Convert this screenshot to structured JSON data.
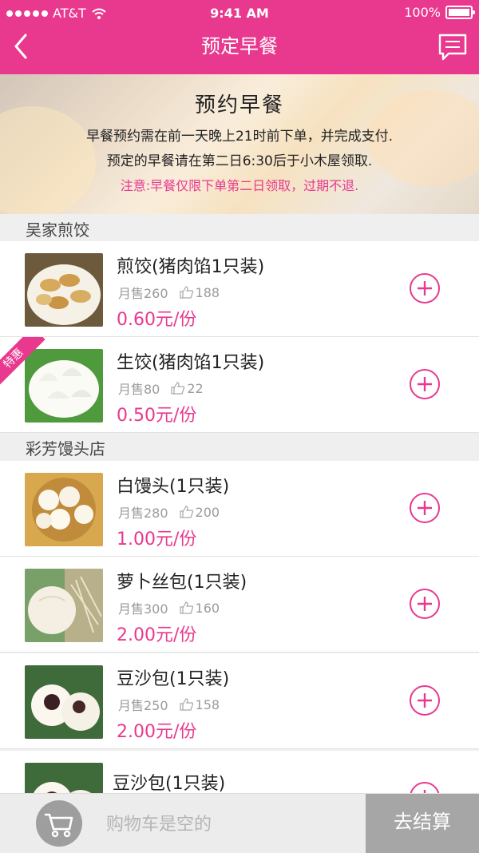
{
  "status": {
    "carrier": "AT&T",
    "time": "9:41 AM",
    "battery": "100%"
  },
  "nav": {
    "title": "预定早餐"
  },
  "banner": {
    "heading": "预约早餐",
    "line1": "早餐预约需在前一天晚上21时前下单，并完成支付.",
    "line2": "预定的早餐请在第二日6:30后于小木屋领取.",
    "note": "注意:早餐仅限下单第二日领取，过期不退."
  },
  "sections": [
    {
      "name": "吴家煎饺",
      "items": [
        {
          "name": "煎饺(猪肉馅1只装)",
          "sales": "月售260",
          "likes": "188",
          "price": "0.60元/份"
        },
        {
          "name": "生饺(猪肉馅1只装)",
          "sales": "月售80",
          "likes": "22",
          "price": "0.50元/份",
          "badge": "特惠"
        }
      ]
    },
    {
      "name": "彩芳馒头店",
      "items": [
        {
          "name": "白馒头(1只装)",
          "sales": "月售280",
          "likes": "200",
          "price": "1.00元/份"
        },
        {
          "name": "萝卜丝包(1只装)",
          "sales": "月售300",
          "likes": "160",
          "price": "2.00元/份"
        },
        {
          "name": "豆沙包(1只装)",
          "sales": "月售250",
          "likes": "158",
          "price": "2.00元/份"
        },
        {
          "name": "豆沙包(1只装)"
        }
      ]
    }
  ],
  "cart": {
    "empty_label": "购物车是空的",
    "checkout_label": "去结算"
  },
  "colors": {
    "accent": "#e8398f",
    "cart_bg": "#ececec",
    "checkout_bg": "#a6a6a6"
  }
}
